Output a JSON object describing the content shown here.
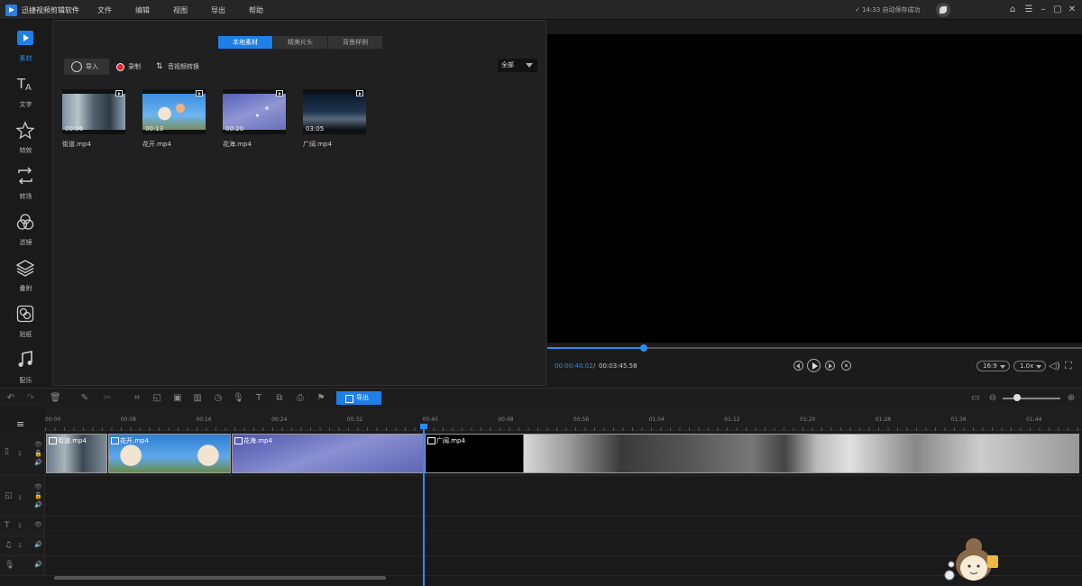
{
  "app": {
    "title": "迅捷视频剪辑软件"
  },
  "menu": [
    "文件",
    "编辑",
    "视图",
    "导出",
    "帮助"
  ],
  "status": {
    "autosave": "14:33 自动保存成功"
  },
  "sidebar": {
    "items": [
      {
        "label": "素材",
        "icon": "media-icon",
        "active": true
      },
      {
        "label": "文字",
        "icon": "text-icon"
      },
      {
        "label": "特效",
        "icon": "effects-icon"
      },
      {
        "label": "转场",
        "icon": "transition-icon"
      },
      {
        "label": "滤镜",
        "icon": "filter-icon"
      },
      {
        "label": "叠附",
        "icon": "overlay-icon"
      },
      {
        "label": "贴纸",
        "icon": "sticker-icon"
      },
      {
        "label": "配乐",
        "icon": "music-icon"
      }
    ]
  },
  "media": {
    "tabs": [
      "本地素材",
      "精美片头",
      "背景样例"
    ],
    "import_label": "导入",
    "record_label": "录制",
    "convert_label": "音视频转换",
    "filter_value": "全部",
    "clips": [
      {
        "name": "街道.mp4",
        "duration": "00:06"
      },
      {
        "name": "花开.mp4",
        "duration": "00:13"
      },
      {
        "name": "花海.mp4",
        "duration": "00:20"
      },
      {
        "name": "广阔.mp4",
        "duration": "03:05"
      }
    ]
  },
  "preview": {
    "current_time": "00:00:40.02",
    "separator": "/",
    "total_time": "00:03:45.58",
    "progress": 0.18,
    "aspect": "16:9",
    "speed": "1.0x"
  },
  "toolbar": {
    "export_label": "导出",
    "zoom": 0.25
  },
  "timeline": {
    "ruler_ticks": [
      "00:00",
      "00:08",
      "00:16",
      "00:24",
      "00:32",
      "00:40",
      "00:48",
      "00:56",
      "01:04",
      "01:12",
      "01:20",
      "01:28",
      "01:36",
      "01:44"
    ],
    "video_clips": [
      "街道.mp4",
      "花开.mp4",
      "花海.mp4",
      "广阔.mp4"
    ],
    "track_numbers": [
      "1",
      "1",
      "1",
      "1"
    ]
  },
  "colors": {
    "accent": "#1e7fe6",
    "background": "#1b1b1b",
    "panel": "#202020"
  }
}
